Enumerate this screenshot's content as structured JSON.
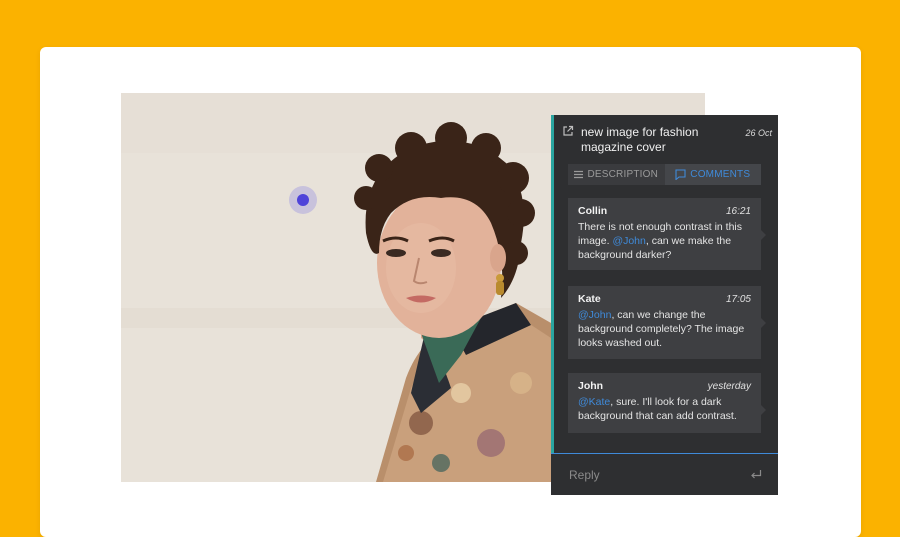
{
  "colors": {
    "background": "#FBB200",
    "panel": "#2e2f31",
    "accent": "#3f8ad9",
    "pin": "#4e43d9",
    "teal_edge": "#2aa5a0"
  },
  "photo": {
    "alt_icon": "portrait-photo"
  },
  "panel": {
    "title": "new image for fashion magazine cover",
    "date": "26 Oct",
    "tabs": [
      {
        "label": "DESCRIPTION",
        "icon": "lines-icon",
        "active": false
      },
      {
        "label": "COMMENTS",
        "icon": "comment-icon",
        "active": true
      }
    ],
    "comments": [
      {
        "author": "Collin",
        "time": "16:21",
        "text_before": "There is not enough contrast in this image. ",
        "mention": "@John",
        "text_after": ", can we make the background darker?"
      },
      {
        "author": "Kate",
        "time": "17:05",
        "text_before": "",
        "mention": "@John",
        "text_after": ", can we change the background completely? The image looks washed out."
      },
      {
        "author": "John",
        "time": "yesterday",
        "text_before": "",
        "mention": "@Kate",
        "text_after": ", sure. I'll look for a dark background that can add contrast."
      }
    ],
    "reply_placeholder": "Reply"
  }
}
